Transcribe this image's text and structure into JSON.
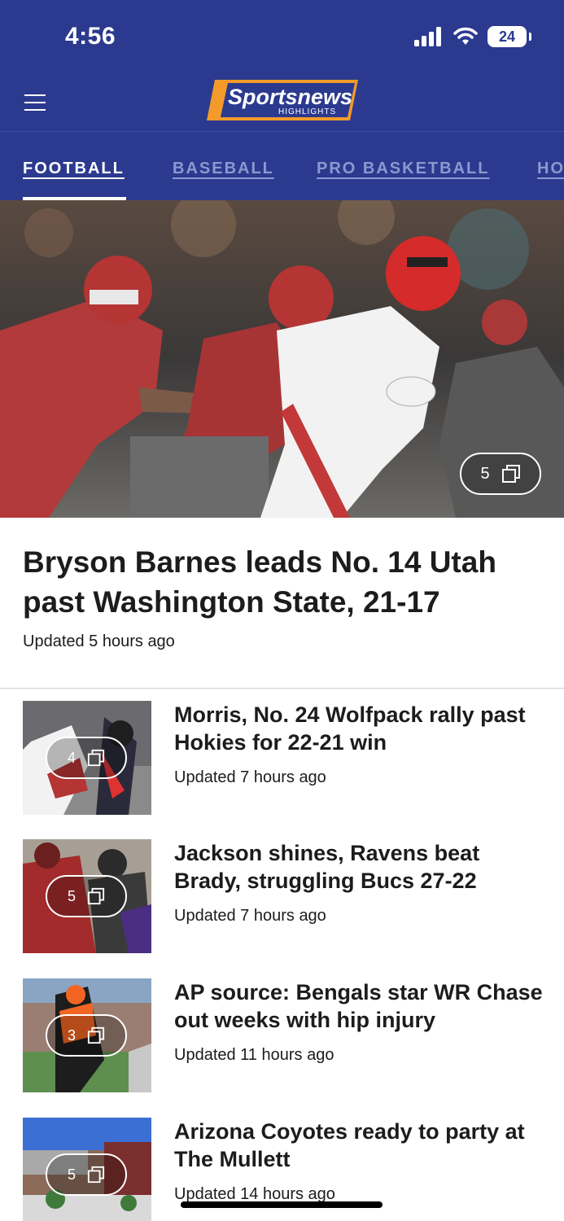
{
  "status_bar": {
    "time": "4:56",
    "battery": "24"
  },
  "header": {
    "logo_main": "Sportsnews",
    "logo_sub": "HIGHLIGHTS"
  },
  "tabs": [
    {
      "label": "FOOTBALL",
      "active": true
    },
    {
      "label": "BASEBALL",
      "active": false
    },
    {
      "label": "PRO BASKETBALL",
      "active": false
    },
    {
      "label": "HO",
      "active": false
    }
  ],
  "hero": {
    "title": "Bryson Barnes leads No. 14 Utah past Washington State, 21-17",
    "updated": "Updated 5 hours ago",
    "photo_count": "5"
  },
  "articles": [
    {
      "title": "Morris, No. 24 Wolfpack rally past Hokies for 22-21 win",
      "updated": "Updated 7 hours ago",
      "photo_count": "4"
    },
    {
      "title": "Jackson shines, Ravens beat Brady, struggling Bucs 27-22",
      "updated": "Updated 7 hours ago",
      "photo_count": "5"
    },
    {
      "title": "AP source: Bengals star WR Chase out weeks with hip injury",
      "updated": "Updated 11 hours ago",
      "photo_count": "3"
    },
    {
      "title": "Arizona Coyotes ready to party at The Mullett",
      "updated": "Updated 14 hours ago",
      "photo_count": "5"
    }
  ],
  "colors": {
    "brand": "#2b3a8f",
    "accent": "#f39a2a",
    "text": "#1c1c1c"
  },
  "icons": {
    "menu": "menu-icon",
    "gallery": "gallery-icon",
    "signal": "signal-icon",
    "wifi": "wifi-icon",
    "battery": "battery-icon"
  }
}
